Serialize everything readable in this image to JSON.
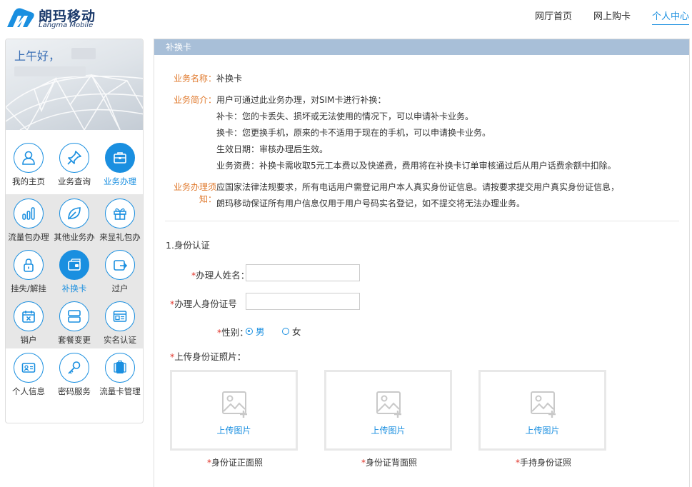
{
  "brand": {
    "name_cn": "朗玛移动",
    "name_en": "Langma Mobile"
  },
  "topnav": {
    "items": [
      "网厅首页",
      "网上购卡",
      "个人中心"
    ],
    "active": "个人中心"
  },
  "sidebar": {
    "greeting": "上午好，",
    "menu": [
      {
        "label": "我的主页",
        "icon": "user-icon"
      },
      {
        "label": "业务查询",
        "icon": "pushpin-icon"
      },
      {
        "label": "业务办理",
        "icon": "briefcase-icon",
        "active": true
      },
      {
        "label": "流量包办理",
        "icon": "bar-chart-icon"
      },
      {
        "label": "其他业务办",
        "icon": "leaf-icon"
      },
      {
        "label": "来显礼包办",
        "icon": "gift-icon"
      },
      {
        "label": "挂失/解挂",
        "icon": "lock-icon"
      },
      {
        "label": "补换卡",
        "icon": "card-icon",
        "active": true
      },
      {
        "label": "过户",
        "icon": "transfer-icon"
      },
      {
        "label": "销户",
        "icon": "calendar-x-icon"
      },
      {
        "label": "套餐变更",
        "icon": "package-icon"
      },
      {
        "label": "实名认证",
        "icon": "id-card-icon"
      },
      {
        "label": "个人信息",
        "icon": "profile-card-icon"
      },
      {
        "label": "密码服务",
        "icon": "key-icon"
      },
      {
        "label": "流量卡管理",
        "icon": "sim-cards-icon"
      }
    ]
  },
  "panel": {
    "title": "补换卡",
    "info": {
      "name_label": "业务名称：",
      "name_value": "补换卡",
      "intro_label": "业务简介：",
      "intro_lines": [
        "用户可通过此业务办理，对SIM卡进行补换：",
        "补卡：您的卡丢失、损坏或无法使用的情况下，可以申请补卡业务。",
        "换卡：您更换手机，原来的卡不适用于现在的手机，可以申请换卡业务。",
        "生效日期：审核办理后生效。",
        "业务资费：补换卡需收取5元工本费以及快递费，费用将在补换卡订单审核通过后从用户话费余额中扣除。"
      ],
      "notice_label_1": "业务办理须",
      "notice_label_2": "知：",
      "notice_lines": [
        "应国家法律法规要求，所有电话用户需登记用户本人真实身份证信息。请按要求提交用户真实身份证信息，",
        "朗玛移动保证所有用户信息仅用于用户号码实名登记，如不提交将无法办理业务。"
      ]
    },
    "form": {
      "section_title": "1.身份认证",
      "required_mark": "*",
      "name_label": "办理人姓名：",
      "id_label": "办理人身份证号",
      "gender_label": "性别：",
      "gender_options": [
        "男",
        "女"
      ],
      "gender_selected": "男",
      "photo_label": "上传身份证照片：",
      "upload_text": "上传图片",
      "uploads": [
        "身份证正面照",
        "身份证背面照",
        "手持身份证照"
      ]
    }
  },
  "colors": {
    "accent": "#1a8fe0",
    "label_orange": "#e07a2e",
    "required_red": "#e0352b",
    "title_bar": "#a8bfd8"
  }
}
